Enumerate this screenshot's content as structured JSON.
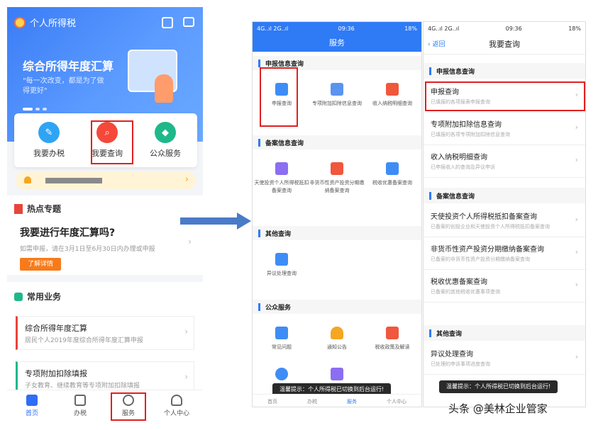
{
  "panel1": {
    "app_title": "个人所得税",
    "banner": {
      "title": "综合所得年度汇算",
      "subtitle": "\"每一次改变，都是为了做得更好\""
    },
    "quick": [
      {
        "label": "我要办税",
        "icon": "pen-icon",
        "color": "#2fa4f5"
      },
      {
        "label": "我要查询",
        "icon": "search-icon",
        "color": "#f5483a"
      },
      {
        "label": "公众服务",
        "icon": "shield-icon",
        "color": "#1fb88a"
      }
    ],
    "hot": {
      "heading": "热点专题",
      "question": "我要进行年度汇算吗?",
      "desc": "如需申报，请在3月1日至6月30日内办理或申报",
      "button": "了解详情"
    },
    "common": {
      "heading": "常用业务",
      "items": [
        {
          "title": "综合所得年度汇算",
          "sub": "居民个人2019年度综合所得年度汇算申报"
        },
        {
          "title": "专项附加扣除填报",
          "sub": "子女教育、继续教育等专项附加扣除填报"
        }
      ]
    },
    "tabs": [
      "首页",
      "办税",
      "服务",
      "个人中心"
    ]
  },
  "panel2": {
    "status": {
      "left": "4G..ıl 2G..ıl",
      "time": "09:36",
      "right": "18%"
    },
    "title": "服务",
    "sections": [
      {
        "label": "申报信息查询",
        "items": [
          "申报查询",
          "专项附加扣除信息查询",
          "收入纳税明细查询"
        ]
      },
      {
        "label": "备案信息查询",
        "items": [
          "天使投资个人所得税抵扣备案查询",
          "非货币性资产投资分期缴纳备案查询",
          "税收优惠备案查询"
        ]
      },
      {
        "label": "其他查询",
        "items": [
          "异议处理查询"
        ]
      },
      {
        "label": "公众服务",
        "items": [
          "常见问题",
          "通知公告",
          "税收政策及解读"
        ]
      }
    ],
    "toast": "温馨提示：个人所得税已切换到后台运行!",
    "tabs": [
      "首页",
      "办税",
      "服务",
      "个人中心"
    ]
  },
  "panel3": {
    "status": {
      "left": "4G..ıl 2G..ıl",
      "time": "09:36",
      "right": "18%"
    },
    "back": "返回",
    "title": "我要查询",
    "sections": [
      {
        "label": "申报信息查询",
        "items": [
          {
            "t": "申报查询",
            "s": "已填报的各项报表申报查询"
          },
          {
            "t": "专项附加扣除信息查询",
            "s": "已填报的各项专项附加扣除信息查询"
          },
          {
            "t": "收入纳税明细查询",
            "s": "已申报收入的查询及异议申诉"
          }
        ]
      },
      {
        "label": "备案信息查询",
        "items": [
          {
            "t": "天使投资个人所得税抵扣备案查询",
            "s": "已备案的创投企业和天使投资个人所得税抵扣备案查询"
          },
          {
            "t": "非货币性资产投资分期缴纳备案查询",
            "s": "已备案的非货币性资产投资分期缴纳备案查询"
          },
          {
            "t": "税收优惠备案查询",
            "s": "已备案的其他税收优惠事项查询"
          }
        ]
      },
      {
        "label": "其他查询",
        "items": [
          {
            "t": "异议处理查询",
            "s": "已处理的申诉事项进度查询"
          }
        ]
      }
    ],
    "toast": "温馨提示：个人所得税已切换到后台运行!"
  },
  "watermark": "头条 @美林企业管家"
}
